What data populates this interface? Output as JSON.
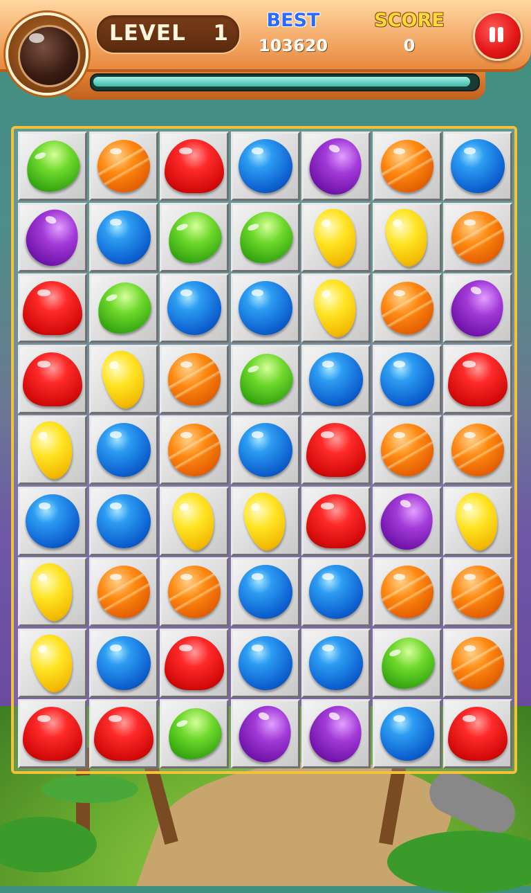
{
  "hud": {
    "level_label": "LEVEL",
    "level_value": "1",
    "best_label": "BEST",
    "best_value": "103620",
    "score_label": "SCORE",
    "score_value": "0",
    "progress_fraction": 0.99
  },
  "colors": {
    "red": "#e41818",
    "orange": "#ff8a12",
    "blue": "#0c5fcf",
    "green": "#2fa10e",
    "purple": "#a23ad8",
    "yellow": "#ffe424"
  },
  "board": {
    "rows": 9,
    "cols": 7,
    "candies": [
      [
        "green",
        "orange",
        "red",
        "blue",
        "purple",
        "orange",
        "blue"
      ],
      [
        "purple",
        "blue",
        "green",
        "green",
        "yellow",
        "yellow",
        "orange"
      ],
      [
        "red",
        "green",
        "blue",
        "blue",
        "yellow",
        "orange",
        "purple"
      ],
      [
        "red",
        "yellow",
        "orange",
        "green",
        "blue",
        "blue",
        "red"
      ],
      [
        "yellow",
        "blue",
        "orange",
        "blue",
        "red",
        "orange",
        "orange"
      ],
      [
        "blue",
        "blue",
        "yellow",
        "yellow",
        "red",
        "purple",
        "yellow"
      ],
      [
        "yellow",
        "orange",
        "orange",
        "blue",
        "blue",
        "orange",
        "orange"
      ],
      [
        "yellow",
        "blue",
        "red",
        "blue",
        "blue",
        "green",
        "orange"
      ],
      [
        "red",
        "red",
        "green",
        "purple",
        "purple",
        "blue",
        "red"
      ]
    ]
  }
}
